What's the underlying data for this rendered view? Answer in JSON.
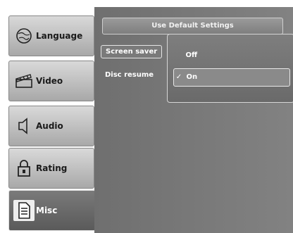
{
  "sidebar": {
    "items": [
      {
        "label": "Language",
        "icon": "globe-icon"
      },
      {
        "label": "Video",
        "icon": "clapperboard-icon"
      },
      {
        "label": "Audio",
        "icon": "speaker-icon"
      },
      {
        "label": "Rating",
        "icon": "lock-icon"
      },
      {
        "label": "Misc",
        "icon": "document-icon"
      }
    ],
    "active_index": 4
  },
  "main": {
    "defaults_button": "Use Default Settings",
    "settings": [
      {
        "label": "Screen saver"
      },
      {
        "label": "Disc resume"
      }
    ]
  },
  "dropdown": {
    "options": [
      {
        "label": "Off",
        "selected": false
      },
      {
        "label": "On",
        "selected": true
      }
    ],
    "check_mark": "✓"
  }
}
